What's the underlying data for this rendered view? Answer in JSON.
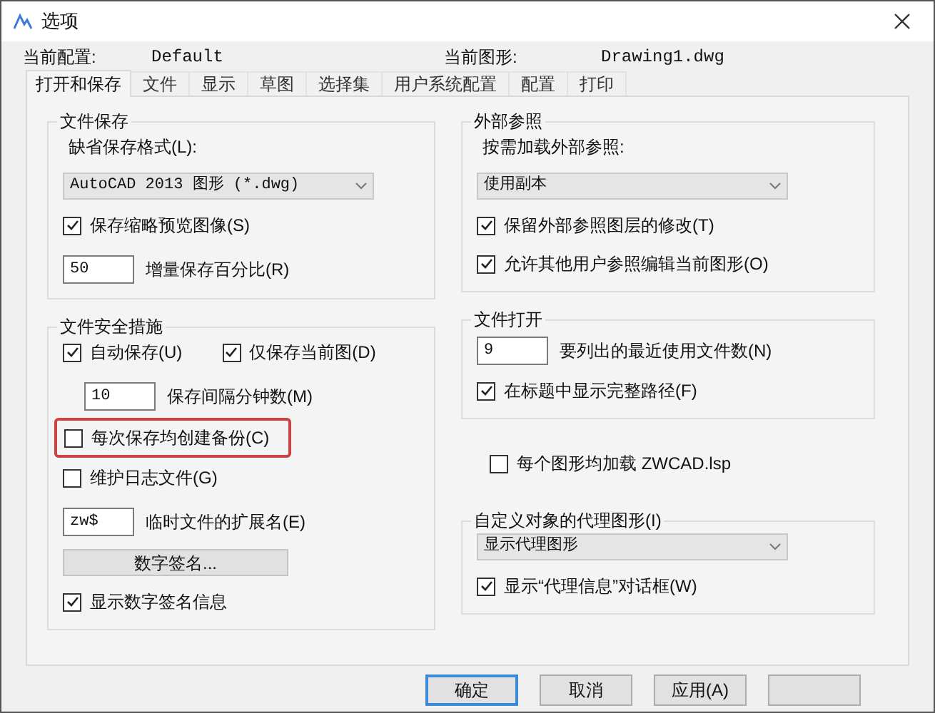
{
  "window": {
    "title": "选项"
  },
  "header": {
    "profile_label": "当前配置:",
    "profile": "Default",
    "drawing_label": "当前图形:",
    "drawing": "Drawing1.dwg"
  },
  "tabs": [
    {
      "label": "打开和保存",
      "selected": true
    },
    {
      "label": "文件",
      "selected": false
    },
    {
      "label": "显示",
      "selected": false
    },
    {
      "label": "草图",
      "selected": false
    },
    {
      "label": "选择集",
      "selected": false
    },
    {
      "label": "用户系统配置",
      "selected": false
    },
    {
      "label": "配置",
      "selected": false
    },
    {
      "label": "打印",
      "selected": false
    }
  ],
  "columns": [
    [
      {
        "kind": "group",
        "title": "文件保存",
        "items": [
          {
            "kind": "label",
            "text": "缺省保存格式(L):"
          },
          {
            "kind": "dropdown",
            "value": "AutoCAD 2013 图形 (*.dwg)"
          },
          {
            "kind": "checkbox",
            "label": "保存缩略预览图像(S)",
            "checked": true,
            "highlighted": false
          },
          {
            "kind": "field",
            "value": "50",
            "text": "增量保存百分比(R)"
          }
        ]
      },
      {
        "kind": "group",
        "title": "文件安全措施",
        "items": [
          {
            "kind": "checkbox_row",
            "checkboxes": [
              {
                "label": "自动保存(U)",
                "checked": true,
                "highlighted": false
              },
              {
                "label": "仅保存当前图(D)",
                "checked": true,
                "highlighted": false
              }
            ]
          },
          {
            "kind": "field_indented",
            "value": "10",
            "text": "保存间隔分钟数(M)"
          },
          {
            "kind": "checkbox",
            "label": "每次保存均创建备份(C)",
            "checked": false,
            "highlighted": true
          },
          {
            "kind": "checkbox",
            "label": "维护日志文件(G)",
            "checked": false,
            "highlighted": false
          },
          {
            "kind": "field",
            "value": "zw$",
            "text": "临时文件的扩展名(E)"
          },
          {
            "kind": "button",
            "label": "数字签名..."
          },
          {
            "kind": "checkbox",
            "label": "显示数字签名信息",
            "checked": true,
            "highlighted": false
          }
        ]
      }
    ],
    [
      {
        "kind": "group",
        "title": "外部参照",
        "items": [
          {
            "kind": "label",
            "text": "按需加载外部参照:"
          },
          {
            "kind": "dropdown",
            "value": "使用副本"
          },
          {
            "kind": "checkbox",
            "label": "保留外部参照图层的修改(T)",
            "checked": true,
            "highlighted": false
          },
          {
            "kind": "checkbox",
            "label": "允许其他用户参照编辑当前图形(O)",
            "checked": true,
            "highlighted": false
          }
        ]
      },
      {
        "kind": "group",
        "title": "文件打开",
        "items": [
          {
            "kind": "field",
            "value": "9",
            "text": "要列出的最近使用文件数(N)"
          },
          {
            "kind": "checkbox",
            "label": "在标题中显示完整路径(F)",
            "checked": true,
            "highlighted": false
          }
        ]
      },
      {
        "kind": "checkbox",
        "label": "每个图形均加载 ZWCAD.lsp",
        "checked": false,
        "highlighted": false
      },
      {
        "kind": "group",
        "title": "自定义对象的代理图形(I)",
        "items": [
          {
            "kind": "dropdown",
            "value": "显示代理图形"
          },
          {
            "kind": "checkbox",
            "label": "显示“代理信息”对话框(W)",
            "checked": true,
            "highlighted": false
          }
        ]
      }
    ]
  ],
  "buttons": [
    {
      "label": "确定",
      "default": true
    },
    {
      "label": "取消",
      "default": false
    },
    {
      "label": "应用(A)",
      "default": false
    },
    {
      "default": false
    }
  ]
}
